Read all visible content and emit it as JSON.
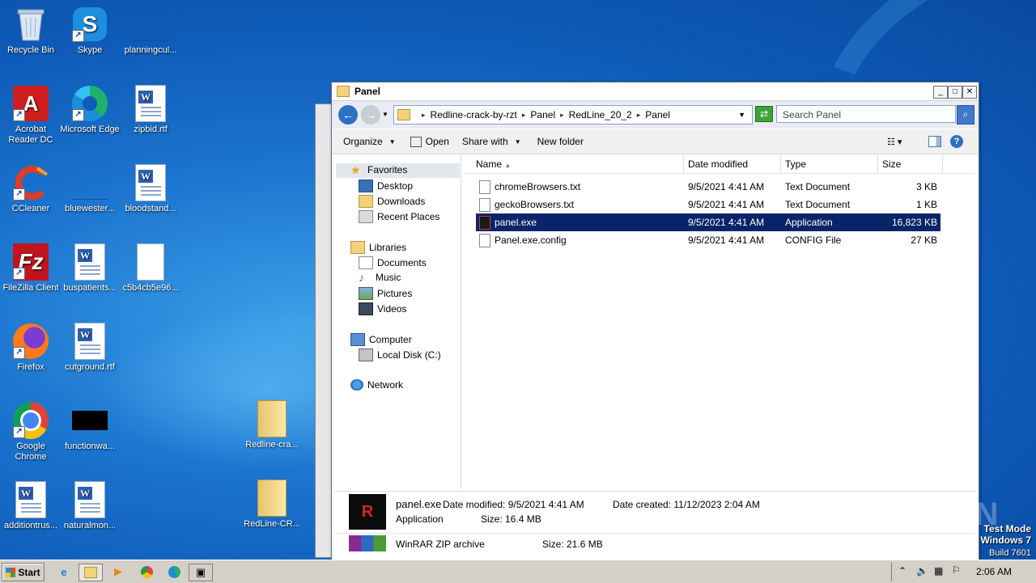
{
  "desktop": {
    "icons": [
      {
        "label": "Recycle Bin"
      },
      {
        "label": "Skype"
      },
      {
        "label": "planningcul..."
      },
      {
        "label": "Acrobat Reader DC"
      },
      {
        "label": "Microsoft Edge"
      },
      {
        "label": "zipbid.rtf"
      },
      {
        "label": "CCleaner"
      },
      {
        "label": "bluewester..."
      },
      {
        "label": "bloodstand..."
      },
      {
        "label": "FileZilla Client"
      },
      {
        "label": "buspatients..."
      },
      {
        "label": "c5b4cb5e96..."
      },
      {
        "label": "Firefox"
      },
      {
        "label": "cutground.rtf"
      },
      {
        "label": "Google Chrome"
      },
      {
        "label": "functionwa..."
      },
      {
        "label": "Redline-cra..."
      },
      {
        "label": "additiontrus..."
      },
      {
        "label": "naturalmon..."
      },
      {
        "label": "RedLine-CR..."
      }
    ]
  },
  "window": {
    "title": "Panel",
    "address": [
      "Redline-crack-by-rzt",
      "Panel",
      "RedLine_20_2",
      "Panel"
    ],
    "search_placeholder": "Search Panel",
    "commands": {
      "organize": "Organize",
      "open": "Open",
      "share": "Share with",
      "new_folder": "New folder"
    },
    "nav": {
      "favorites": "Favorites",
      "desktop": "Desktop",
      "downloads": "Downloads",
      "recent": "Recent Places",
      "libraries": "Libraries",
      "documents": "Documents",
      "music": "Music",
      "pictures": "Pictures",
      "videos": "Videos",
      "computer": "Computer",
      "local_disk": "Local Disk (C:)",
      "network": "Network"
    },
    "columns": {
      "name": "Name",
      "date": "Date modified",
      "type": "Type",
      "size": "Size"
    },
    "files": [
      {
        "name": "chromeBrowsers.txt",
        "date": "9/5/2021 4:41 AM",
        "type": "Text Document",
        "size": "3 KB"
      },
      {
        "name": "geckoBrowsers.txt",
        "date": "9/5/2021 4:41 AM",
        "type": "Text Document",
        "size": "1 KB"
      },
      {
        "name": "panel.exe",
        "date": "9/5/2021 4:41 AM",
        "type": "Application",
        "size": "16,823 KB"
      },
      {
        "name": "Panel.exe.config",
        "date": "9/5/2021 4:41 AM",
        "type": "CONFIG File",
        "size": "27 KB"
      }
    ],
    "details": {
      "name": "panel.exe",
      "modified": "Date modified: 9/5/2021 4:41 AM",
      "created": "Date created: 11/12/2023 2:04 AM",
      "type": "Application",
      "size": "Size: 16.4 MB"
    },
    "details2": {
      "type": "WinRAR ZIP archive",
      "size": "Size: 21.6 MB"
    }
  },
  "taskbar": {
    "start": "Start",
    "clock": "2:06 AM"
  },
  "watermark": {
    "line1": "Test Mode",
    "line2": "Windows 7",
    "line3": "Build 7601",
    "brand": "ANY RUN"
  }
}
